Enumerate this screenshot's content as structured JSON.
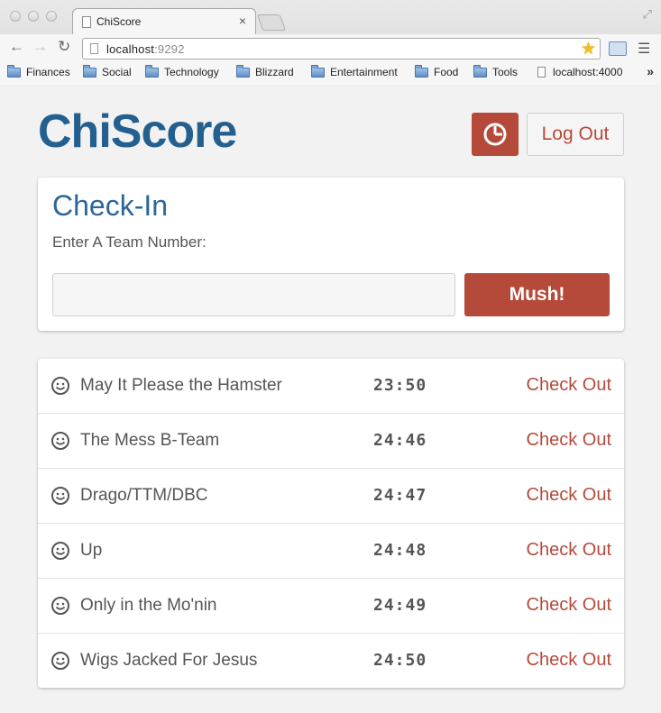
{
  "browser": {
    "tab_title": "ChiScore",
    "tab_close": "×",
    "url_host": "localhost",
    "url_port": ":9292",
    "bookmarks": [
      {
        "label": "Finances",
        "type": "folder"
      },
      {
        "label": "Social",
        "type": "folder"
      },
      {
        "label": "Technology",
        "type": "folder"
      },
      {
        "label": "Blizzard",
        "type": "folder"
      },
      {
        "label": "Entertainment",
        "type": "folder"
      },
      {
        "label": "Food",
        "type": "folder"
      },
      {
        "label": "Tools",
        "type": "folder"
      },
      {
        "label": "localhost:4000",
        "type": "page"
      }
    ],
    "bookmarks_more": "»"
  },
  "header": {
    "logo": "ChiScore",
    "timer_icon": "clock-icon",
    "logout_label": "Log Out"
  },
  "checkin": {
    "title": "Check-In",
    "label": "Enter A Team Number:",
    "input_value": "",
    "submit_label": "Mush!"
  },
  "teams": [
    {
      "name": "May It Please the Hamster",
      "time": "23:50",
      "action": "Check Out"
    },
    {
      "name": "The Mess B-Team",
      "time": "24:46",
      "action": "Check Out"
    },
    {
      "name": "Drago/TTM/DBC",
      "time": "24:47",
      "action": "Check Out"
    },
    {
      "name": "Up",
      "time": "24:48",
      "action": "Check Out"
    },
    {
      "name": "Only in the Mo'nin",
      "time": "24:49",
      "action": "Check Out"
    },
    {
      "name": "Wigs Jacked For Jesus",
      "time": "24:50",
      "action": "Check Out"
    }
  ],
  "colors": {
    "brand_blue": "#24608f",
    "accent_red": "#b64a3a"
  }
}
